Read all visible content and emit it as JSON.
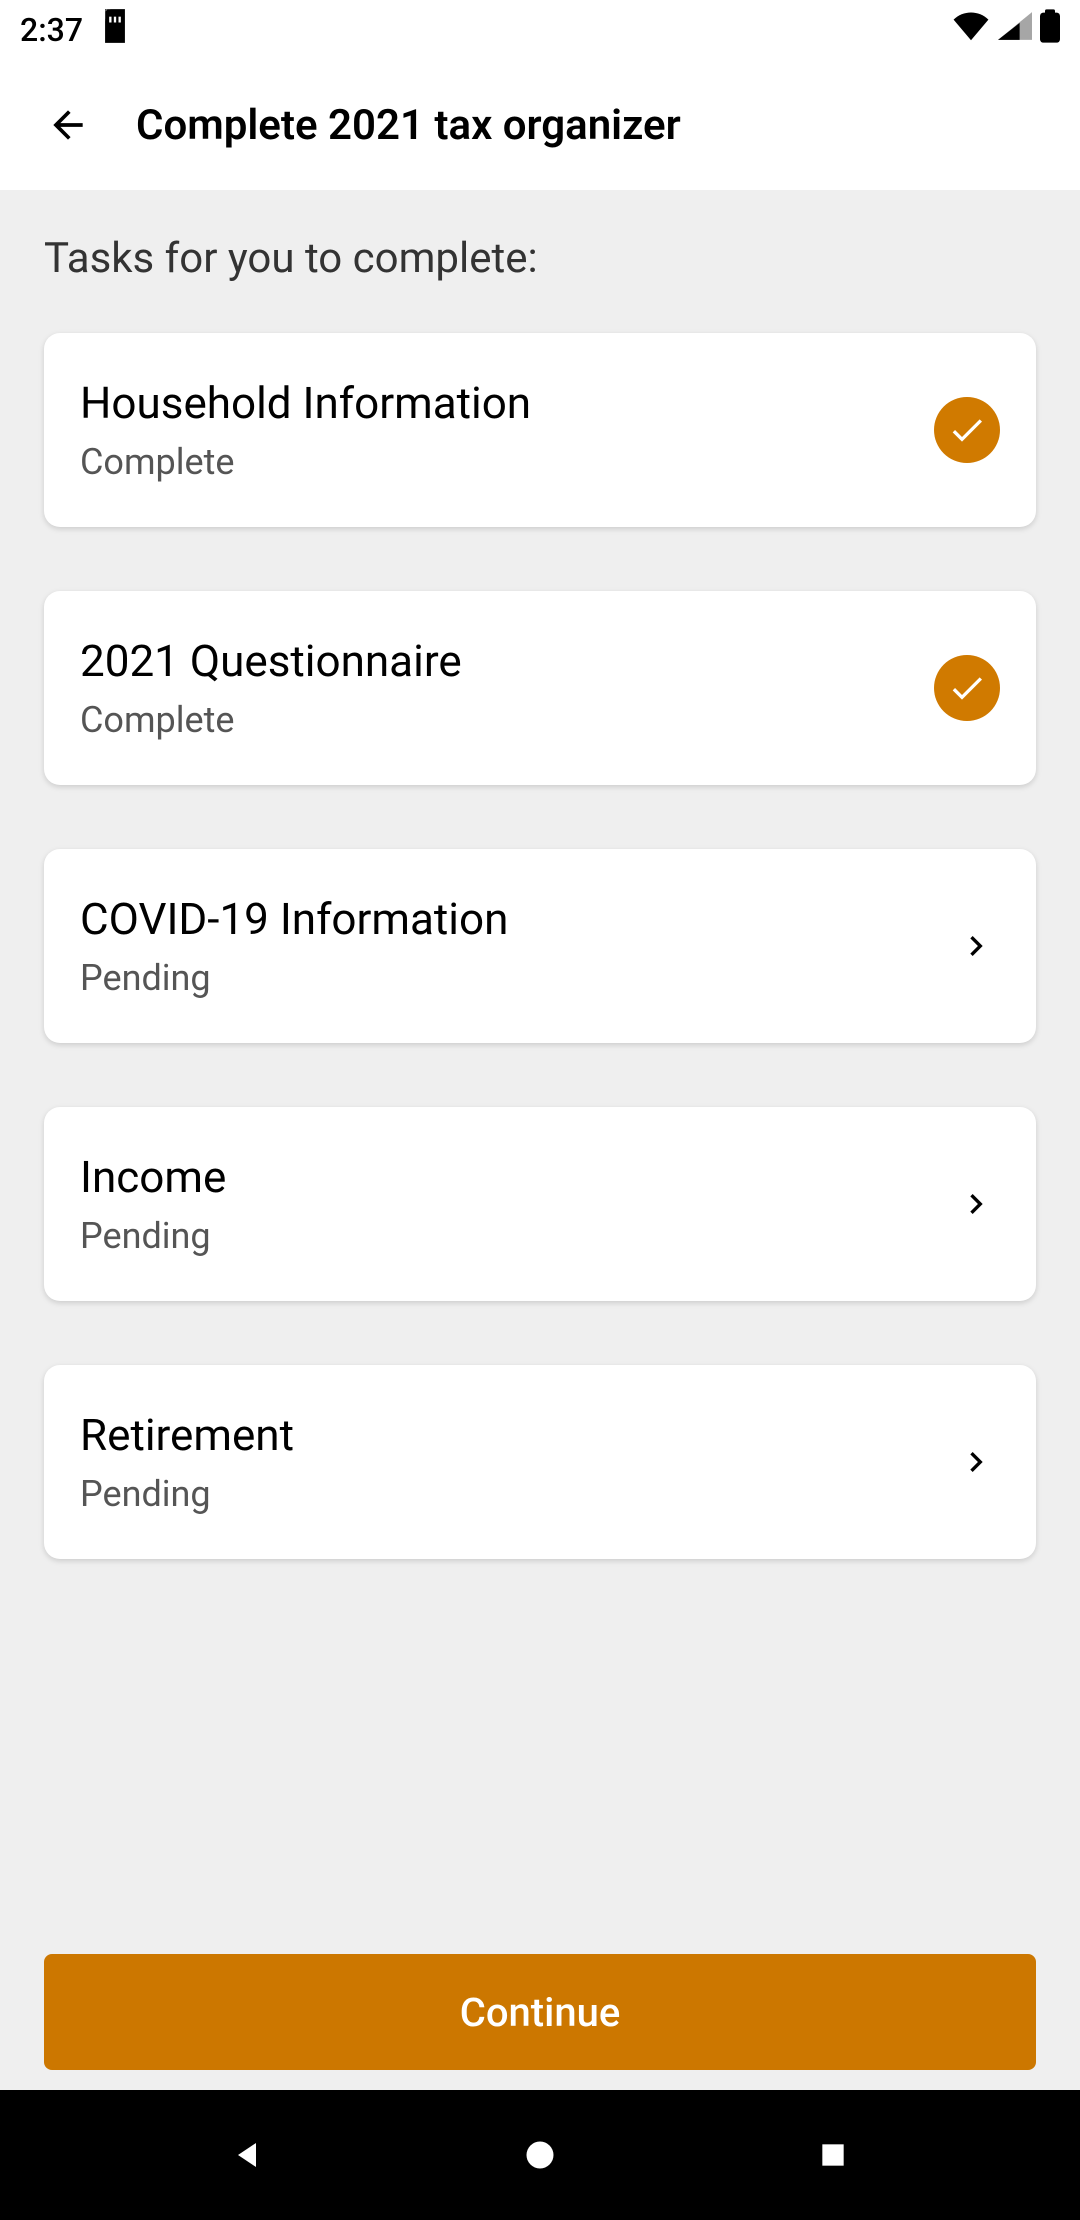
{
  "status_bar": {
    "time": "2:37"
  },
  "header": {
    "title": "Complete 2021 tax organizer"
  },
  "content": {
    "section_heading": "Tasks for you to complete:",
    "tasks": [
      {
        "title": "Household Information",
        "status": "Complete",
        "complete": true
      },
      {
        "title": "2021 Questionnaire",
        "status": "Complete",
        "complete": true
      },
      {
        "title": "COVID-19 Information",
        "status": "Pending",
        "complete": false
      },
      {
        "title": "Income",
        "status": "Pending",
        "complete": false
      },
      {
        "title": "Retirement",
        "status": "Pending",
        "complete": false
      }
    ]
  },
  "footer": {
    "continue_label": "Continue"
  },
  "colors": {
    "accent": "#cc7700"
  }
}
